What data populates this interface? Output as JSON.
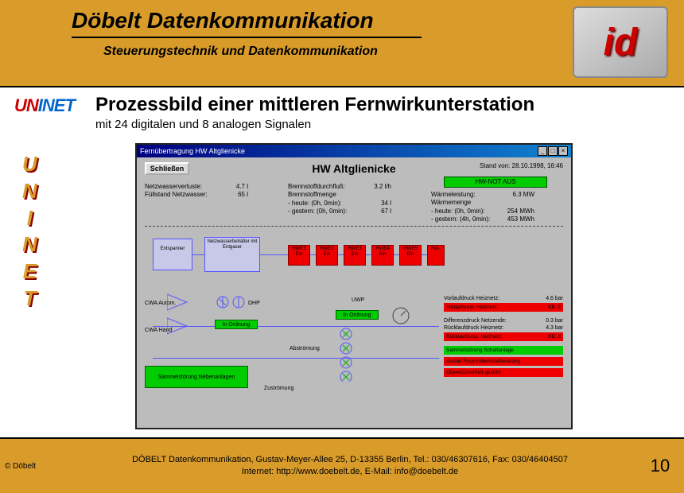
{
  "header": {
    "title": "Döbelt Datenkommunikation",
    "subtitle": "Steuerungstechnik und Datenkommunikation",
    "logo_text": "id"
  },
  "brand": {
    "uninet": [
      "U",
      "N",
      "I",
      "N",
      "E",
      "T"
    ]
  },
  "content": {
    "title": "Prozessbild einer mittleren Fernwirkunterstation",
    "subtitle": "mit 24 digitalen und 8 analogen Signalen"
  },
  "sidebar_letters": [
    "U",
    "N",
    "I",
    "N",
    "E",
    "T"
  ],
  "window": {
    "titlebar": "Fernübertragung HW Altglienicke",
    "close_label": "Schließen",
    "heading": "HW Altglienicke",
    "timestamp": "Stand von: 28.10.1998, 16:46",
    "not_aus": "HW-NOT AUS",
    "col1": [
      {
        "lbl": "Netzwasserverluste:",
        "val": "4.7 l"
      },
      {
        "lbl": "Füllstand Netzwasser:",
        "val": "65 l"
      }
    ],
    "col2": [
      {
        "lbl": "Brennstoffdurchfluß:",
        "val": "3.2 l/h"
      },
      {
        "lbl": "Brennstoffmenge",
        "val": ""
      },
      {
        "lbl": "- heute: (0h, 0min):",
        "val": "34 l"
      },
      {
        "lbl": "- gestern: (0h, 0min):",
        "val": "67 l"
      }
    ],
    "col3": [
      {
        "lbl": "Wärmeleistung:",
        "val": "6.3 MW"
      },
      {
        "lbl": "Wärmemenge",
        "val": ""
      },
      {
        "lbl": "- heute: (0h, 0min):",
        "val": "254 MWh"
      },
      {
        "lbl": "- gestern: (4h, 0min):",
        "val": "453 MWh"
      }
    ],
    "schematic": {
      "entspanner": "Entspanner",
      "netzwasser": "Netzwasserbehälter mit Entgaser",
      "cwa_autom": "CWA Autom.",
      "cwa_hand": "CWA Hand",
      "dhp": "DHP",
      "uwp": "UWP",
      "in_ordnung": "In Ordnung",
      "abstroemung": "Abströmung",
      "zustroemung": "Zuströmung",
      "sammelstoerung": "Sammelstörung Nebenanlagen",
      "hwe_labels": [
        "HWE1",
        "HWE2",
        "HWE3",
        "HWE4",
        "HWE5",
        "Res."
      ],
      "hwe_sub": "Ein"
    },
    "measurements": {
      "rows": [
        {
          "lbl": "Vorlaufdruck Heiznetz:",
          "val": "4.6 bar"
        },
        {
          "lbl_bar": "Vorlauftemp. Heiznetz:",
          "val_bar": "KB. II",
          "cls": "red"
        },
        {
          "lbl": "Differenzdruck Netzende:",
          "val": "0.3 bar"
        },
        {
          "lbl": "Rücklaufdruck Heiznetz:",
          "val": "4.3 bar"
        },
        {
          "lbl_bar": "Rücklauftemp. Heiznetz:",
          "val_bar": "KB. II",
          "cls": "red"
        },
        {
          "lbl_bar": "Sammelstörung Schaltanlage",
          "val_bar": "",
          "cls": "green"
        },
        {
          "lbl_bar": "Ausfall Flughindernisbefeuerung",
          "val_bar": "",
          "cls": "red"
        },
        {
          "lbl_bar": "Objektsicherheit gestört",
          "val_bar": "",
          "cls": "red"
        }
      ]
    }
  },
  "footer": {
    "copyright": "© Döbelt",
    "line1": "DÖBELT Datenkommunikation, Gustav-Meyer-Allee 25, D-13355 Berlin, Tel.: 030/46307616, Fax: 030/46404507",
    "line2": "Internet: http://www.doebelt.de, E-Mail: info@doebelt.de",
    "page": "10"
  }
}
